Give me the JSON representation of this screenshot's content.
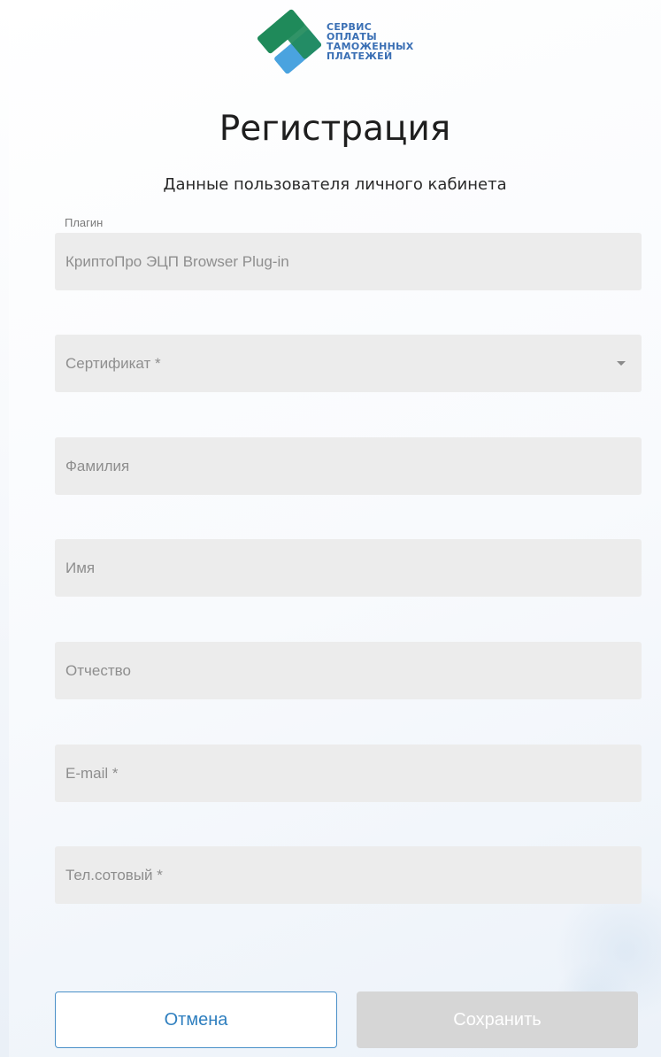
{
  "logo": {
    "lines": [
      "СЕРВИС",
      "ОПЛАТЫ",
      "ТАМОЖЕННЫХ",
      "ПЛАТЕЖЕЙ"
    ]
  },
  "header": {
    "title": "Регистрация",
    "subtitle": "Данные пользователя личного кабинета"
  },
  "form": {
    "plugin": {
      "label": "Плагин",
      "value": "КриптоПро ЭЦП Browser Plug-in"
    },
    "certificate": {
      "placeholder": "Сертификат *"
    },
    "last_name": {
      "placeholder": "Фамилия"
    },
    "first_name": {
      "placeholder": "Имя"
    },
    "middle_name": {
      "placeholder": "Отчество"
    },
    "email": {
      "placeholder": "E-mail *"
    },
    "phone": {
      "placeholder": "Тел.сотовый *"
    }
  },
  "actions": {
    "cancel_label": "Отмена",
    "save_label": "Сохранить"
  },
  "colors": {
    "logo_green": "#1f8a5a",
    "logo_blue": "#4aa3df",
    "accent": "#2f7fbf",
    "field_bg": "#ececec",
    "disabled_button": "#d6d6d6"
  }
}
